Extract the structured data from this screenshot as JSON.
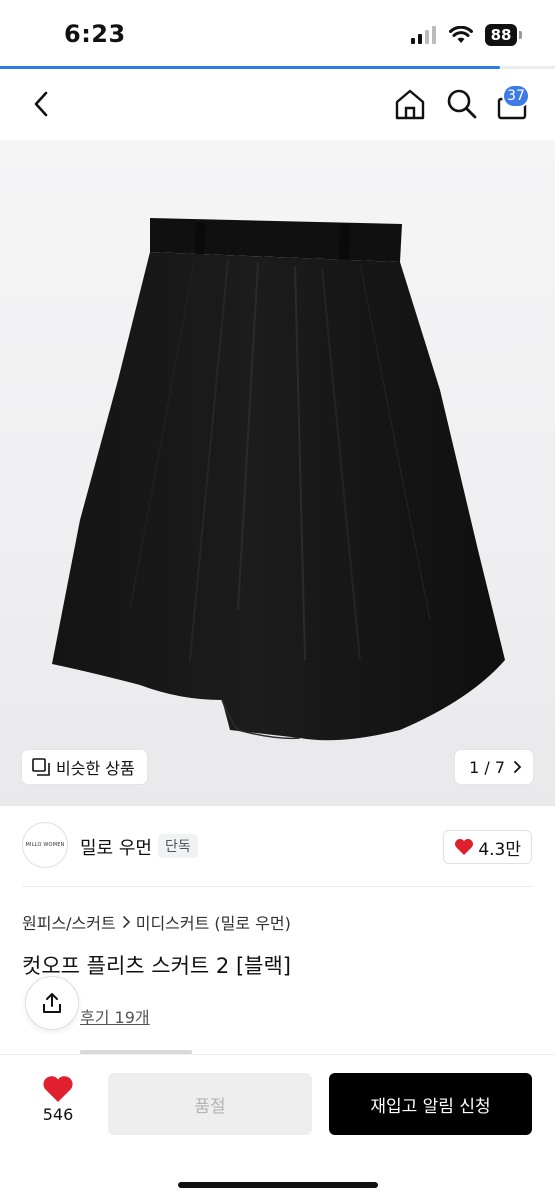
{
  "status": {
    "time": "6:23",
    "battery": "88"
  },
  "page_load_progress": 0.9,
  "nav": {
    "back_icon": "chevron-left-icon",
    "home_icon": "home-icon",
    "search_icon": "search-icon",
    "cart_icon": "shopping-bag-icon",
    "cart_count": "37",
    "accent": "#3d7be6"
  },
  "gallery": {
    "similar_label": "비슷한 상품",
    "page_indicator": "1 / 7"
  },
  "brand": {
    "logo_text": "MILLO WOMEN",
    "name": "밀로 우먼",
    "tag": "단독",
    "like_count": "4.3만"
  },
  "product": {
    "breadcrumb": [
      "원피스/스커트",
      "미디스커트 (밀로 우먼)"
    ],
    "title": "컷오프 플리츠 스커트 2 [블랙]",
    "review_label": "후기 19개"
  },
  "bottom": {
    "wish_count": "546",
    "soldout_label": "품절",
    "restock_label": "재입고 알림 신청",
    "heart_color": "#e0202f"
  }
}
